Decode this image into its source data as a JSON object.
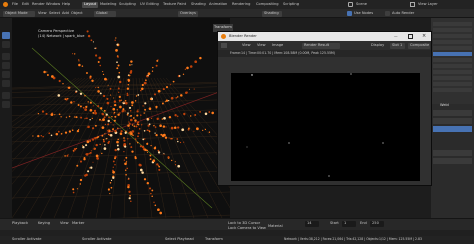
{
  "topbar": {
    "menus": [
      "File",
      "Edit",
      "Render",
      "Window",
      "Help"
    ],
    "workspaces": [
      "Layout",
      "Modeling",
      "Sculpting",
      "UV Editing",
      "Texture Paint",
      "Shading",
      "Animation",
      "Rendering",
      "Compositing",
      "Scripting"
    ],
    "active_workspace": "Layout",
    "scene_label": "Scene",
    "view_layer_label": "View Layer"
  },
  "header": {
    "mode": "Object Mode",
    "items": [
      "View",
      "Select",
      "Add",
      "Object"
    ],
    "transform": "Global",
    "overlays": "Overlays",
    "shading": "Shading",
    "use_nodes": "Use Nodes",
    "auto_render": "Auto Render"
  },
  "viewport": {
    "title": "Camera Perspective",
    "collection": "(14) Network | spark_blue",
    "transform_tab": "Transform"
  },
  "render_window": {
    "title": "Blender Render",
    "menu": [
      "View",
      "View",
      "Image"
    ],
    "slot_name": "Render Result",
    "display": "Display",
    "slot": "Slot 1",
    "pass": "Composite",
    "info": "Frame:14 | Time:00:01.70 | Mem:108.58M (0.00M, Peak 125.55M)"
  },
  "properties": {
    "label": "Weld",
    "rows": 12
  },
  "timeline": {
    "menus": [
      "Playback",
      "Keying",
      "View",
      "Marker"
    ],
    "frame_current": "14",
    "start": "Start",
    "start_value": "1",
    "end": "End",
    "end_value": "250",
    "lock_camera": "Lock Camera to View",
    "lock_3d_cursor": "Lock to 3D Cursor",
    "material": "Material"
  },
  "status": {
    "items": [
      "Scroller Activate",
      "Scroller Activate",
      "Select Playhead",
      "Transform"
    ],
    "stats": "Network | Verts:38,212 | Faces:21,064 | Tris:42,128 | Objects:1/12 | Mem: 125.55M | 2.83"
  },
  "colors": {
    "accent": "#4772b3",
    "particle": "#ff7a1a",
    "bg": "#1d1d1d"
  }
}
